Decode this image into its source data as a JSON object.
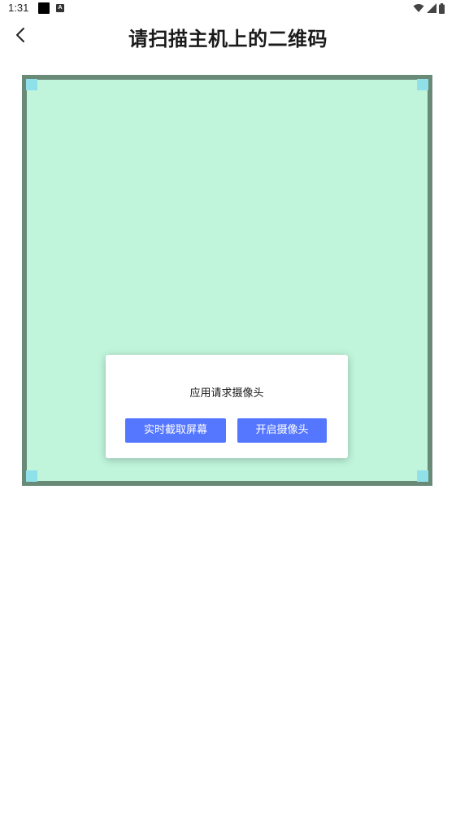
{
  "status_bar": {
    "time": "1:31",
    "notification_badge": "A",
    "icons": [
      "black-square-icon",
      "a-badge-icon",
      "wifi-icon",
      "signal-icon",
      "battery-icon"
    ]
  },
  "header": {
    "back_icon": "chevron-left-icon",
    "title": "请扫描主机上的二维码"
  },
  "scanner": {
    "colors": {
      "fill": "#c0f5dc",
      "frame": "#6a8a78",
      "corner": "#8fe0e8"
    }
  },
  "dialog": {
    "message": "应用请求摄像头",
    "capture_button": "实时截取屏幕",
    "camera_button": "开启摄像头",
    "colors": {
      "button": "#5577ff"
    }
  }
}
